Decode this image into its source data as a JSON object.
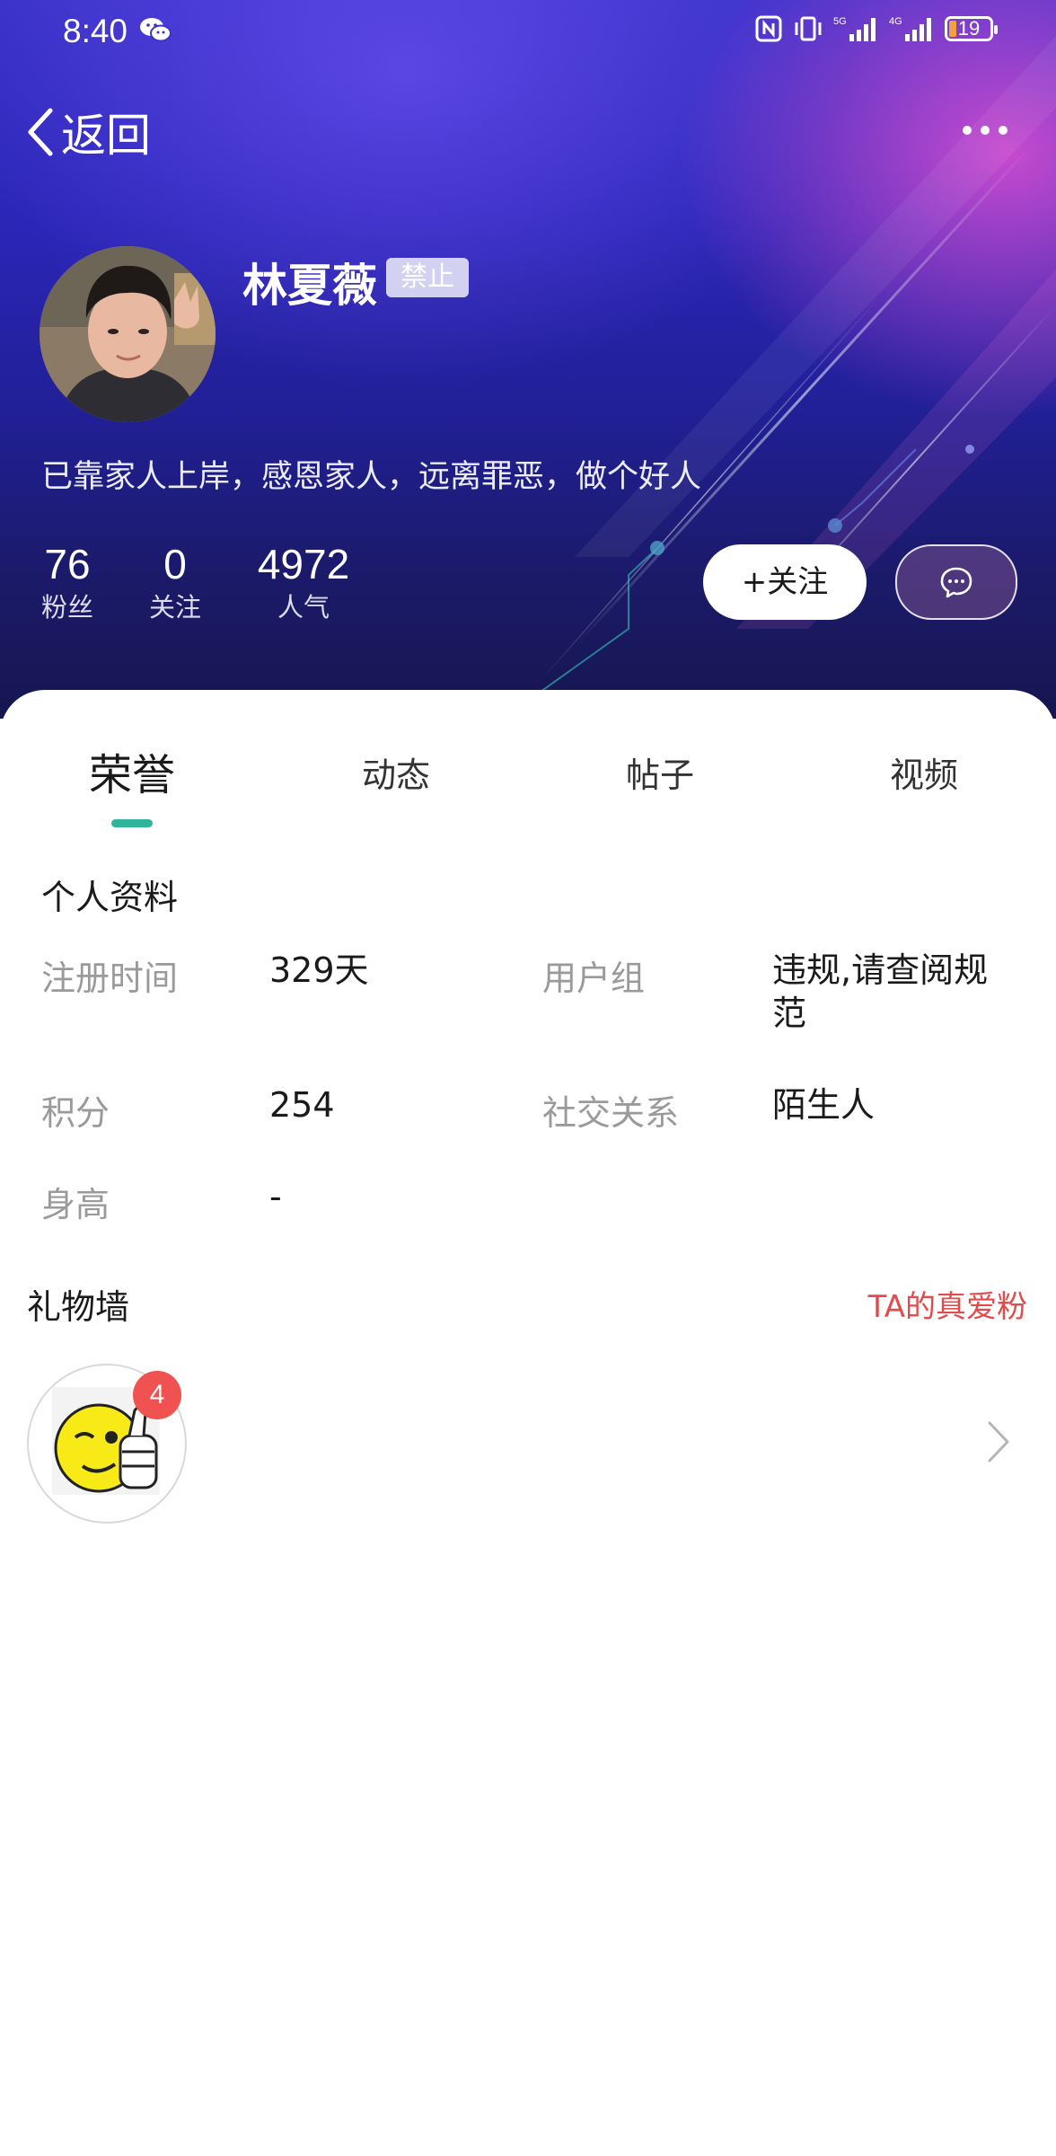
{
  "status_bar": {
    "time": "8:40",
    "battery_level": "19"
  },
  "nav": {
    "back_label": "返回"
  },
  "profile": {
    "name": "林夏薇",
    "badge": "禁止",
    "bio": "已靠家人上岸，感恩家人，远离罪恶，做个好人",
    "stats": [
      {
        "value": "76",
        "label": "粉丝"
      },
      {
        "value": "0",
        "label": "关注"
      },
      {
        "value": "4972",
        "label": "人气"
      }
    ],
    "follow_label": "+关注"
  },
  "tabs": [
    {
      "label": "荣誉",
      "active": true
    },
    {
      "label": "动态",
      "active": false
    },
    {
      "label": "帖子",
      "active": false
    },
    {
      "label": "视频",
      "active": false
    }
  ],
  "personal_info": {
    "title": "个人资料",
    "fields": [
      {
        "label": "注册时间",
        "value": "329天"
      },
      {
        "label": "用户组",
        "value_line1": "违规,请查阅规",
        "value_line2": "范"
      },
      {
        "label": "积分",
        "value": "254"
      },
      {
        "label": "社交关系",
        "value": "陌生人"
      },
      {
        "label": "身高",
        "value": "-"
      }
    ]
  },
  "gift_wall": {
    "title": "礼物墙",
    "link": "TA的真爱粉",
    "gift_count": "4"
  },
  "colors": {
    "accent": "#2fb59b",
    "link_red": "#e24b4b",
    "badge_red": "#f05252"
  }
}
